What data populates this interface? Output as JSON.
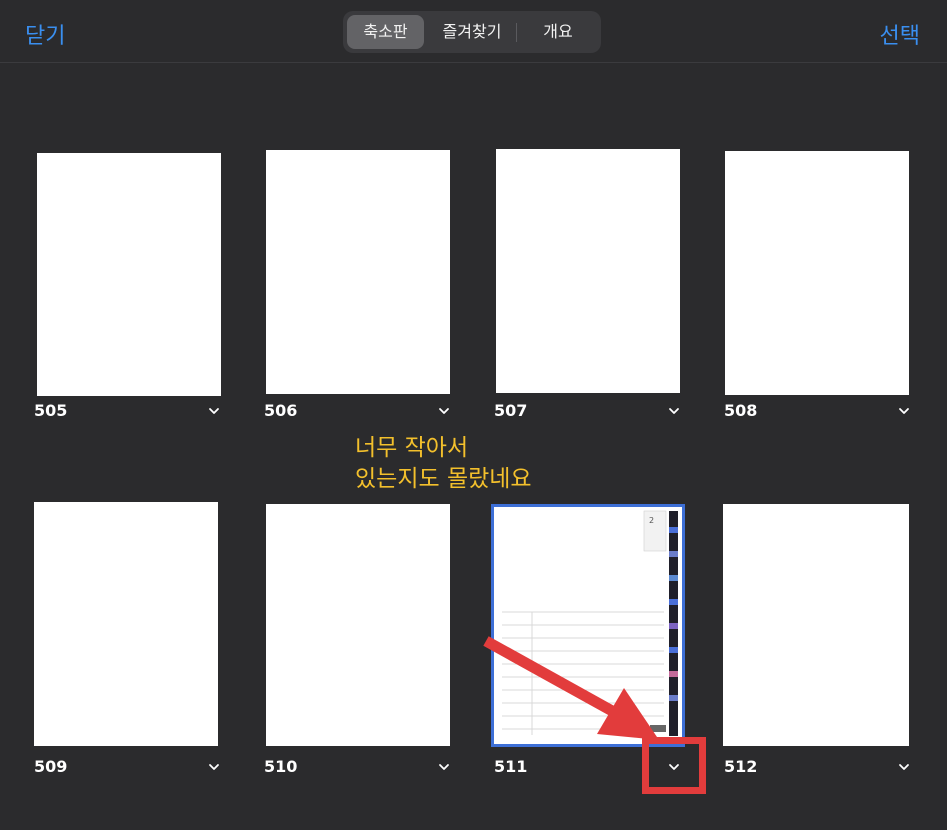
{
  "toolbar": {
    "close_label": "닫기",
    "select_label": "선택",
    "segments": [
      {
        "label": "축소판",
        "active": true
      },
      {
        "label": "즐겨찾기",
        "active": false
      },
      {
        "label": "개요",
        "active": false
      }
    ]
  },
  "pages": [
    {
      "number": "505",
      "selected": false
    },
    {
      "number": "506",
      "selected": false
    },
    {
      "number": "507",
      "selected": false
    },
    {
      "number": "508",
      "selected": false
    },
    {
      "number": "509",
      "selected": false
    },
    {
      "number": "510",
      "selected": false
    },
    {
      "number": "511",
      "selected": true,
      "corner_text": "2"
    },
    {
      "number": "512",
      "selected": false
    }
  ],
  "annotation": {
    "line1": "너무 작아서",
    "line2": "있는지도 몰랐네요",
    "color": "#f3c02c",
    "arrow_color": "#e23c3c"
  },
  "colors": {
    "background": "#2b2b2d",
    "accent": "#3a8ff0",
    "selection_border": "#3d6fd6"
  }
}
